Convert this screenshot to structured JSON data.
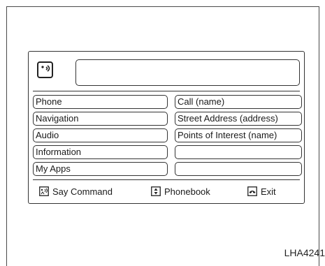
{
  "commands_left": [
    "Phone",
    "Navigation",
    "Audio",
    "Information",
    "My Apps"
  ],
  "commands_right": [
    "Call (name)",
    "Street Address (address)",
    "Points of Interest (name)",
    "",
    ""
  ],
  "footer": {
    "say_command": "Say Command",
    "phonebook": "Phonebook",
    "exit": "Exit"
  },
  "icons": {
    "voice": "voice-recognition-icon",
    "say_command": "talk-switch-icon",
    "phonebook": "phonebook-switch-icon",
    "exit": "hang-up-icon"
  },
  "figure_code": "LHA4241"
}
